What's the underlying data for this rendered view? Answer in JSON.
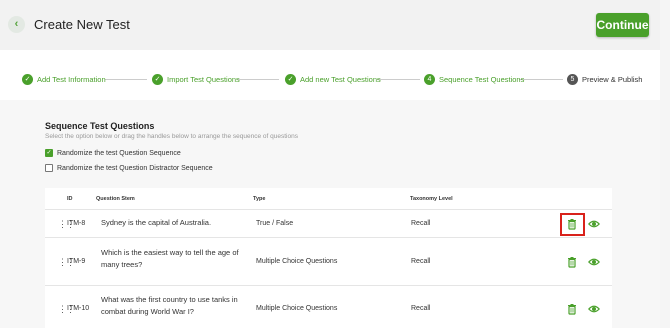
{
  "header": {
    "title": "Create New Test",
    "back_icon": "chevron-left-icon",
    "continue_label": "Continue"
  },
  "steps": [
    {
      "num": "✓",
      "label": "Add Test Information",
      "status": "done"
    },
    {
      "num": "✓",
      "label": "Import Test Questions",
      "status": "done"
    },
    {
      "num": "✓",
      "label": "Add new Test Questions",
      "status": "done"
    },
    {
      "num": "4",
      "label": "Sequence Test Questions",
      "status": "active"
    },
    {
      "num": "5",
      "label": "Preview & Publish",
      "status": "pending"
    }
  ],
  "section": {
    "title": "Sequence Test Questions",
    "subtitle": "Select the option below or drag the handles below to arrange the sequence of questions",
    "options": [
      {
        "label": "Randomize the test Question Sequence",
        "checked": true
      },
      {
        "label": "Randomize the test Question Distractor Sequence",
        "checked": false
      }
    ]
  },
  "table": {
    "headers": {
      "id": "ID",
      "stem": "Question Stem",
      "type": "Type",
      "taxonomy": "Taxonomy Level"
    },
    "rows": [
      {
        "id": "ITM-8",
        "stem": "Sydney is the capital of Australia.",
        "type": "True / False",
        "taxonomy": "Recall"
      },
      {
        "id": "ITM-9",
        "stem": "Which is the easiest way to tell the age of many trees?",
        "type": "Multiple Choice Questions",
        "taxonomy": "Recall"
      },
      {
        "id": "ITM-10",
        "stem": "What was the first country to use tanks in combat during World War I?",
        "type": "Multiple Choice Questions",
        "taxonomy": "Recall"
      }
    ]
  },
  "colors": {
    "accent": "#4aa02b",
    "highlight": "#d9221b"
  }
}
